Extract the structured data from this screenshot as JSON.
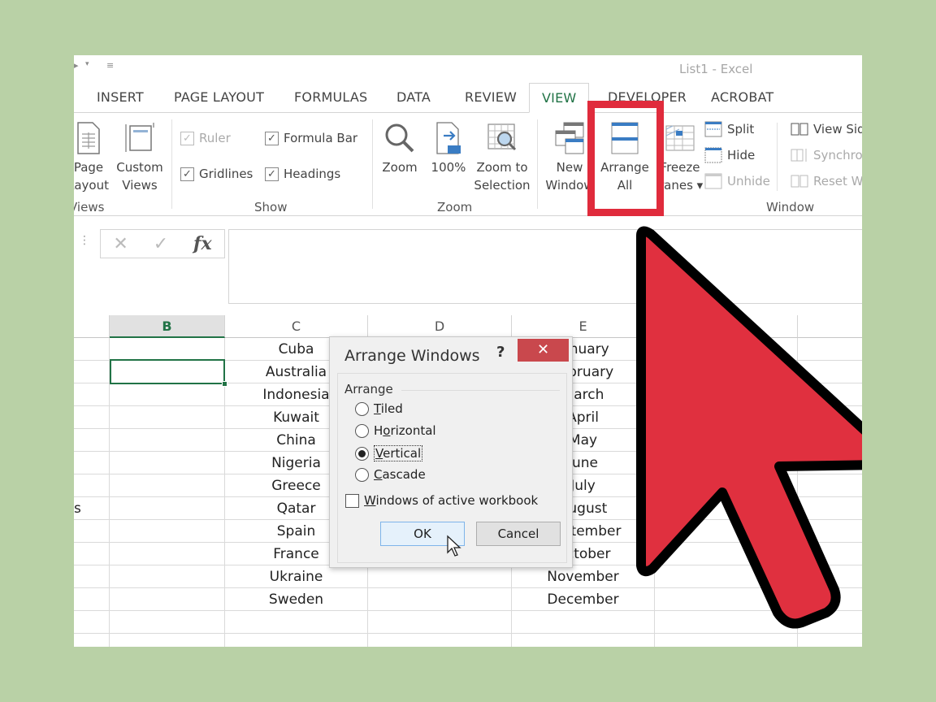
{
  "window": {
    "title": "List1 - Excel"
  },
  "quick_access": {
    "undo_icon": "undo-icon",
    "dropdown_icon": "chevron-down-icon",
    "customize_icon": "customize-qat-icon"
  },
  "tabs": [
    {
      "label": "INSERT"
    },
    {
      "label": "PAGE LAYOUT"
    },
    {
      "label": "FORMULAS"
    },
    {
      "label": "DATA"
    },
    {
      "label": "REVIEW"
    },
    {
      "label": "VIEW",
      "active": true
    },
    {
      "label": "DEVELOPER"
    },
    {
      "label": "ACROBAT"
    }
  ],
  "ribbon": {
    "views_group": {
      "label": "Views",
      "page_layout": "Page Layout",
      "page_layout_l1": "Page",
      "page_layout_l2": "Layout",
      "custom_views_l1": "Custom",
      "custom_views_l2": "Views"
    },
    "show_group": {
      "label": "Show",
      "ruler": {
        "label": "Ruler",
        "checked": true,
        "disabled": true
      },
      "formula_bar": {
        "label": "Formula Bar",
        "checked": true
      },
      "gridlines": {
        "label": "Gridlines",
        "checked": true
      },
      "headings": {
        "label": "Headings",
        "checked": true
      },
      "check_glyph": "✓"
    },
    "zoom_group": {
      "label": "Zoom",
      "zoom": "Zoom",
      "hundred": "100%",
      "hundred_badge": "100",
      "zoom_sel_l1": "Zoom to",
      "zoom_sel_l2": "Selection"
    },
    "window_group": {
      "label": "Window",
      "new_window_l1": "New",
      "new_window_l2": "Window",
      "arrange_all_l1": "Arrange",
      "arrange_all_l2": "All",
      "freeze_l1": "Freeze",
      "freeze_l2": "Panes ▾",
      "split": "Split",
      "hide": "Hide",
      "unhide": "Unhide",
      "view_side": "View Side by Side",
      "sync": "Synchronous Scrolling",
      "reset": "Reset Window Position"
    }
  },
  "formula_bar": {
    "cancel_glyph": "✕",
    "enter_glyph": "✓",
    "fx_label": "fx",
    "value": ""
  },
  "sheet": {
    "columns": [
      "B",
      "C",
      "D",
      "E"
    ],
    "selected_column": "B",
    "partial_a_text": "s",
    "column_c": [
      "Cuba",
      "Australia",
      "Indonesia",
      "Kuwait",
      "China",
      "Nigeria",
      "Greece",
      "Qatar",
      "Spain",
      "France",
      "Ukraine",
      "Sweden"
    ],
    "column_e": [
      "January",
      "February",
      "March",
      "April",
      "May",
      "June",
      "July",
      "August",
      "September",
      "October",
      "November",
      "December"
    ]
  },
  "dialog": {
    "title": "Arrange Windows",
    "help": "?",
    "close": "✕",
    "group_label": "Arrange",
    "options": [
      {
        "pre": "",
        "key": "T",
        "post": "iled",
        "checked": false
      },
      {
        "pre": "H",
        "key": "o",
        "post": "rizontal",
        "checked": false
      },
      {
        "pre": "",
        "key": "V",
        "post": "ertical",
        "checked": true
      },
      {
        "pre": "",
        "key": "C",
        "post": "ascade",
        "checked": false
      }
    ],
    "active_only": {
      "key": "W",
      "post": "indows of active workbook",
      "checked": false
    },
    "ok": "OK",
    "cancel": "Cancel"
  },
  "annotation": {
    "highlight_color": "#e02b3c",
    "cursor_color": "#e0303f"
  }
}
